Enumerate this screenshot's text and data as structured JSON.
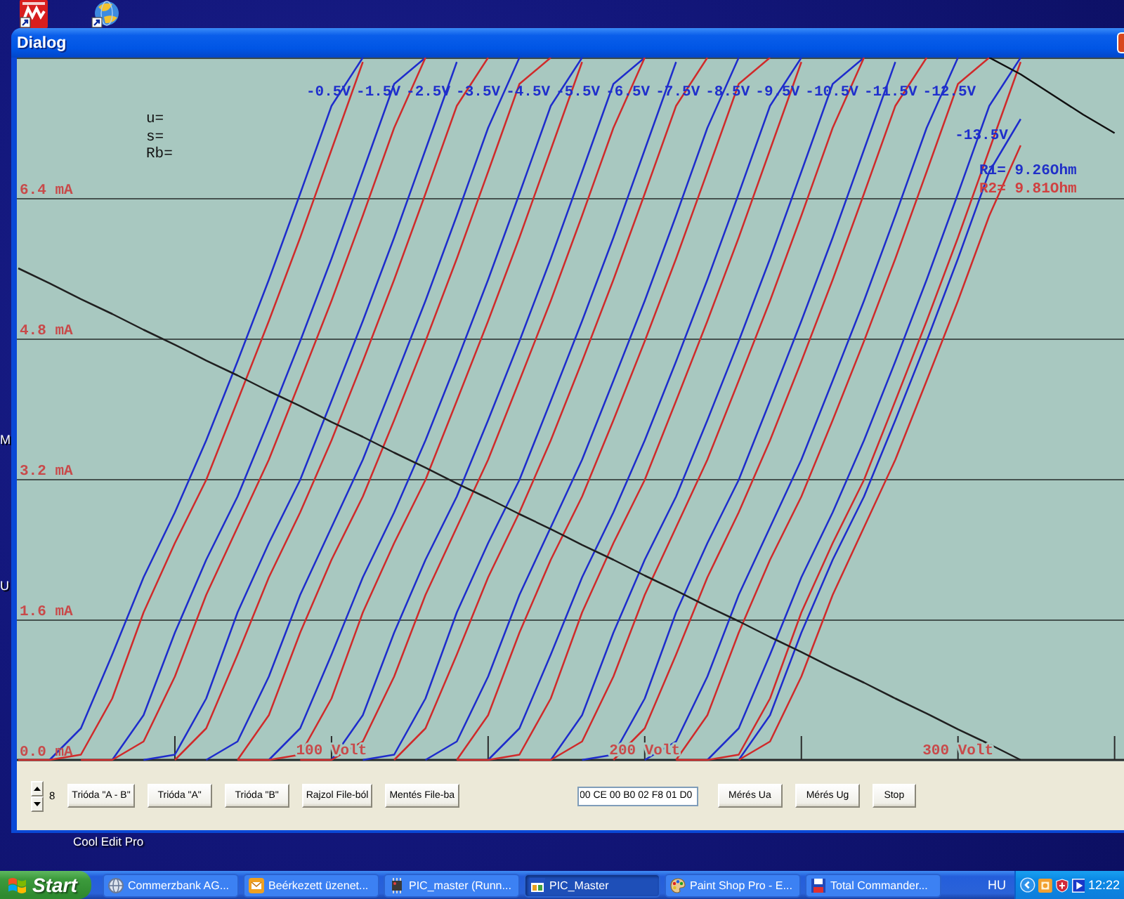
{
  "desktop": {
    "edge_labels": [
      "M",
      "U"
    ],
    "icon_label": "Cool Edit Pro"
  },
  "window": {
    "title": "Dialog"
  },
  "chart": {
    "parameters": [
      "u=",
      "s=",
      "Rb="
    ],
    "resistances": [
      {
        "text": "R1= 9.26Ohm",
        "color": "#2030c8"
      },
      {
        "text": "R2= 9.81Ohm",
        "color": "#d04040"
      }
    ],
    "chart_data": {
      "type": "line",
      "grid": true,
      "x": [
        0,
        10,
        20,
        30,
        40,
        50,
        60,
        70,
        80,
        90,
        100,
        110,
        120,
        130,
        140,
        150,
        160,
        170,
        180,
        190,
        200,
        210,
        220,
        230,
        240,
        250,
        260,
        270,
        280,
        290,
        300,
        310,
        320,
        330,
        340,
        350
      ],
      "xlim": [
        0,
        353
      ],
      "ylim": [
        0,
        8
      ],
      "xticks": [
        {
          "value": 100,
          "label": "100 Volt"
        },
        {
          "value": 200,
          "label": "200 Volt"
        },
        {
          "value": 300,
          "label": "300 Volt"
        }
      ],
      "yticks": [
        {
          "value": 0,
          "label": "0.0 mA"
        },
        {
          "value": 1.6,
          "label": "1.6 mA"
        },
        {
          "value": 3.2,
          "label": "3.2 mA"
        },
        {
          "value": 4.8,
          "label": "4.8 mA"
        },
        {
          "value": 6.4,
          "label": "6.4 mA"
        }
      ],
      "series": [
        {
          "color": "#1e2ccc",
          "values": [
            null,
            0,
            0.36,
            1.2,
            2.08,
            2.82,
            3.64,
            4.54,
            5.47,
            6.45,
            7.45,
            8,
            null,
            null,
            null,
            null,
            null,
            null,
            null,
            null,
            null,
            null,
            null,
            null,
            null,
            null,
            null,
            null,
            null,
            null,
            null,
            null,
            null,
            null,
            null,
            null
          ]
        },
        {
          "color": "#d02a2a",
          "values": [
            0,
            0,
            0.06,
            0.7,
            1.68,
            2.47,
            3.19,
            4.09,
            5.0,
            5.95,
            6.95,
            7.95,
            null,
            null,
            null,
            null,
            null,
            null,
            null,
            null,
            null,
            null,
            null,
            null,
            null,
            null,
            null,
            null,
            null,
            null,
            null,
            null,
            null,
            null,
            null,
            null
          ]
        },
        {
          "color": "#1e2ccc",
          "values": [
            null,
            null,
            null,
            0,
            0.51,
            1.45,
            2.28,
            3.0,
            3.87,
            4.77,
            5.71,
            6.7,
            7.7,
            8,
            null,
            null,
            null,
            null,
            null,
            null,
            null,
            null,
            null,
            null,
            null,
            null,
            null,
            null,
            null,
            null,
            null,
            null,
            null,
            null,
            null,
            null
          ]
        },
        {
          "color": "#d02a2a",
          "values": [
            null,
            null,
            0,
            0,
            0.21,
            0.95,
            1.88,
            2.65,
            3.42,
            4.32,
            5.23,
            6.2,
            7.2,
            8,
            null,
            null,
            null,
            null,
            null,
            null,
            null,
            null,
            null,
            null,
            null,
            null,
            null,
            null,
            null,
            null,
            null,
            null,
            null,
            null,
            null,
            null
          ]
        },
        {
          "color": "#1e2ccc",
          "values": [
            null,
            null,
            null,
            null,
            0,
            0.06,
            0.7,
            1.68,
            2.47,
            3.19,
            4.09,
            5.0,
            5.95,
            6.95,
            7.95,
            null,
            null,
            null,
            null,
            null,
            null,
            null,
            null,
            null,
            null,
            null,
            null,
            null,
            null,
            null,
            null,
            null,
            null,
            null,
            null,
            null
          ]
        },
        {
          "color": "#d02a2a",
          "values": [
            null,
            null,
            null,
            null,
            null,
            0,
            0.36,
            1.2,
            2.08,
            2.82,
            3.64,
            4.54,
            5.47,
            6.45,
            7.45,
            8,
            null,
            null,
            null,
            null,
            null,
            null,
            null,
            null,
            null,
            null,
            null,
            null,
            null,
            null,
            null,
            null,
            null,
            null,
            null,
            null
          ]
        },
        {
          "color": "#1e2ccc",
          "values": [
            null,
            null,
            null,
            null,
            null,
            null,
            0,
            0.21,
            0.95,
            1.88,
            2.65,
            3.42,
            4.32,
            5.23,
            6.2,
            7.2,
            8,
            null,
            null,
            null,
            null,
            null,
            null,
            null,
            null,
            null,
            null,
            null,
            null,
            null,
            null,
            null,
            null,
            null,
            null,
            null
          ]
        },
        {
          "color": "#d02a2a",
          "values": [
            null,
            null,
            null,
            null,
            null,
            null,
            null,
            0,
            0.51,
            1.45,
            2.28,
            3.0,
            3.87,
            4.77,
            5.71,
            6.7,
            7.7,
            8,
            null,
            null,
            null,
            null,
            null,
            null,
            null,
            null,
            null,
            null,
            null,
            null,
            null,
            null,
            null,
            null,
            null,
            null
          ]
        },
        {
          "color": "#1e2ccc",
          "values": [
            null,
            null,
            null,
            null,
            null,
            null,
            null,
            null,
            0,
            0.36,
            1.2,
            2.08,
            2.82,
            3.64,
            4.54,
            5.47,
            6.45,
            7.45,
            8,
            null,
            null,
            null,
            null,
            null,
            null,
            null,
            null,
            null,
            null,
            null,
            null,
            null,
            null,
            null,
            null,
            null
          ]
        },
        {
          "color": "#d02a2a",
          "values": [
            null,
            null,
            null,
            null,
            null,
            null,
            null,
            0,
            0,
            0.06,
            0.7,
            1.68,
            2.47,
            3.19,
            4.09,
            5.0,
            5.95,
            6.95,
            7.95,
            null,
            null,
            null,
            null,
            null,
            null,
            null,
            null,
            null,
            null,
            null,
            null,
            null,
            null,
            null,
            null,
            null
          ]
        },
        {
          "color": "#1e2ccc",
          "values": [
            null,
            null,
            null,
            null,
            null,
            null,
            null,
            null,
            null,
            null,
            0,
            0.51,
            1.45,
            2.28,
            3.0,
            3.87,
            4.77,
            5.71,
            6.7,
            7.7,
            8,
            null,
            null,
            null,
            null,
            null,
            null,
            null,
            null,
            null,
            null,
            null,
            null,
            null,
            null,
            null
          ]
        },
        {
          "color": "#d02a2a",
          "values": [
            null,
            null,
            null,
            null,
            null,
            null,
            null,
            null,
            null,
            0,
            0,
            0.21,
            0.95,
            1.88,
            2.65,
            3.42,
            4.32,
            5.23,
            6.2,
            7.2,
            8,
            null,
            null,
            null,
            null,
            null,
            null,
            null,
            null,
            null,
            null,
            null,
            null,
            null,
            null,
            null
          ]
        },
        {
          "color": "#1e2ccc",
          "values": [
            null,
            null,
            null,
            null,
            null,
            null,
            null,
            null,
            null,
            null,
            null,
            0,
            0.06,
            0.7,
            1.68,
            2.47,
            3.19,
            4.09,
            5.0,
            5.95,
            6.95,
            7.95,
            null,
            null,
            null,
            null,
            null,
            null,
            null,
            null,
            null,
            null,
            null,
            null,
            null,
            null
          ]
        },
        {
          "color": "#d02a2a",
          "values": [
            null,
            null,
            null,
            null,
            null,
            null,
            null,
            null,
            null,
            null,
            null,
            null,
            0,
            0.36,
            1.2,
            2.08,
            2.82,
            3.64,
            4.54,
            5.47,
            6.45,
            7.45,
            8,
            null,
            null,
            null,
            null,
            null,
            null,
            null,
            null,
            null,
            null,
            null,
            null,
            null
          ]
        },
        {
          "color": "#1e2ccc",
          "values": [
            null,
            null,
            null,
            null,
            null,
            null,
            null,
            null,
            null,
            null,
            null,
            null,
            null,
            0,
            0.21,
            0.95,
            1.88,
            2.65,
            3.42,
            4.32,
            5.23,
            6.2,
            7.2,
            8,
            null,
            null,
            null,
            null,
            null,
            null,
            null,
            null,
            null,
            null,
            null,
            null
          ]
        },
        {
          "color": "#d02a2a",
          "values": [
            null,
            null,
            null,
            null,
            null,
            null,
            null,
            null,
            null,
            null,
            null,
            null,
            null,
            null,
            0,
            0.51,
            1.45,
            2.28,
            3.0,
            3.87,
            4.77,
            5.71,
            6.7,
            7.7,
            8,
            null,
            null,
            null,
            null,
            null,
            null,
            null,
            null,
            null,
            null,
            null
          ]
        },
        {
          "color": "#1e2ccc",
          "values": [
            null,
            null,
            null,
            null,
            null,
            null,
            null,
            null,
            null,
            null,
            null,
            null,
            null,
            null,
            null,
            0,
            0.36,
            1.2,
            2.08,
            2.82,
            3.64,
            4.54,
            5.47,
            6.45,
            7.45,
            8,
            null,
            null,
            null,
            null,
            null,
            null,
            null,
            null,
            null,
            null
          ]
        },
        {
          "color": "#d02a2a",
          "values": [
            null,
            null,
            null,
            null,
            null,
            null,
            null,
            null,
            null,
            null,
            null,
            null,
            null,
            null,
            0,
            0,
            0.06,
            0.7,
            1.68,
            2.47,
            3.19,
            4.09,
            5.0,
            5.95,
            6.95,
            7.95,
            null,
            null,
            null,
            null,
            null,
            null,
            null,
            null,
            null,
            null
          ]
        },
        {
          "color": "#1e2ccc",
          "values": [
            null,
            null,
            null,
            null,
            null,
            null,
            null,
            null,
            null,
            null,
            null,
            null,
            null,
            null,
            null,
            null,
            null,
            0,
            0.51,
            1.45,
            2.28,
            3.0,
            3.87,
            4.77,
            5.71,
            6.7,
            7.7,
            8,
            null,
            null,
            null,
            null,
            null,
            null,
            null,
            null
          ]
        },
        {
          "color": "#d02a2a",
          "values": [
            null,
            null,
            null,
            null,
            null,
            null,
            null,
            null,
            null,
            null,
            null,
            null,
            null,
            null,
            null,
            null,
            0,
            0,
            0.21,
            0.95,
            1.88,
            2.65,
            3.42,
            4.32,
            5.23,
            6.2,
            7.2,
            8,
            null,
            null,
            null,
            null,
            null,
            null,
            null,
            null
          ]
        },
        {
          "color": "#1e2ccc",
          "values": [
            null,
            null,
            null,
            null,
            null,
            null,
            null,
            null,
            null,
            null,
            null,
            null,
            null,
            null,
            null,
            null,
            null,
            null,
            0,
            0.06,
            0.7,
            1.68,
            2.47,
            3.19,
            4.09,
            5.0,
            5.95,
            6.95,
            7.95,
            null,
            null,
            null,
            null,
            null,
            null,
            null
          ]
        },
        {
          "color": "#d02a2a",
          "values": [
            null,
            null,
            null,
            null,
            null,
            null,
            null,
            null,
            null,
            null,
            null,
            null,
            null,
            null,
            null,
            null,
            null,
            null,
            null,
            0,
            0.36,
            1.2,
            2.08,
            2.82,
            3.64,
            4.54,
            5.47,
            6.45,
            7.45,
            8,
            null,
            null,
            null,
            null,
            null,
            null
          ]
        },
        {
          "color": "#1e2ccc",
          "values": [
            null,
            null,
            null,
            null,
            null,
            null,
            null,
            null,
            null,
            null,
            null,
            null,
            null,
            null,
            null,
            null,
            null,
            null,
            null,
            null,
            0,
            0.21,
            0.95,
            1.88,
            2.65,
            3.42,
            4.32,
            5.23,
            6.2,
            7.2,
            8,
            null,
            null,
            null,
            null,
            null
          ]
        },
        {
          "color": "#d02a2a",
          "values": [
            null,
            null,
            null,
            null,
            null,
            null,
            null,
            null,
            null,
            null,
            null,
            null,
            null,
            null,
            null,
            null,
            null,
            null,
            null,
            null,
            null,
            0,
            0.51,
            1.45,
            2.28,
            3.0,
            3.87,
            4.77,
            5.71,
            6.7,
            7.7,
            8,
            null,
            null,
            null,
            null
          ]
        },
        {
          "color": "#1e2ccc",
          "values": [
            null,
            null,
            null,
            null,
            null,
            null,
            null,
            null,
            null,
            null,
            null,
            null,
            null,
            null,
            null,
            null,
            null,
            null,
            null,
            null,
            null,
            null,
            0,
            0.36,
            1.2,
            2.08,
            2.82,
            3.64,
            4.54,
            5.47,
            6.45,
            7.45,
            8,
            null,
            null,
            null
          ]
        },
        {
          "color": "#d02a2a",
          "values": [
            null,
            null,
            null,
            null,
            null,
            null,
            null,
            null,
            null,
            null,
            null,
            null,
            null,
            null,
            null,
            null,
            null,
            null,
            null,
            null,
            null,
            0,
            0,
            0.06,
            0.7,
            1.68,
            2.47,
            3.19,
            4.09,
            5.0,
            5.95,
            6.95,
            7.95,
            null,
            null,
            null
          ]
        },
        {
          "color": "#1e2ccc",
          "values": [
            null,
            null,
            null,
            null,
            null,
            null,
            null,
            null,
            null,
            null,
            null,
            null,
            null,
            null,
            null,
            null,
            null,
            null,
            null,
            null,
            null,
            null,
            null,
            0,
            0.51,
            1.45,
            2.28,
            3.0,
            3.87,
            4.77,
            5.71,
            6.7,
            7.3,
            null,
            null,
            null
          ]
        },
        {
          "color": "#d02a2a",
          "values": [
            null,
            null,
            null,
            null,
            null,
            null,
            null,
            null,
            null,
            null,
            null,
            null,
            null,
            null,
            null,
            null,
            null,
            null,
            null,
            null,
            null,
            null,
            null,
            0,
            0.21,
            0.95,
            1.88,
            2.65,
            3.42,
            4.32,
            5.23,
            6.2,
            7.0,
            null,
            null,
            null
          ]
        },
        {
          "color": "#202020",
          "values": [
            5.6,
            5.43,
            5.25,
            5.08,
            4.9,
            4.73,
            4.55,
            4.38,
            4.2,
            4.03,
            3.85,
            3.68,
            3.5,
            3.33,
            3.15,
            2.98,
            2.8,
            2.63,
            2.45,
            2.28,
            2.1,
            1.93,
            1.75,
            1.58,
            1.4,
            1.23,
            1.05,
            0.88,
            0.7,
            0.53,
            0.35,
            0.18,
            0,
            null,
            null,
            null
          ]
        },
        {
          "color": "#101010",
          "values": [
            null,
            null,
            null,
            null,
            null,
            null,
            null,
            null,
            null,
            null,
            null,
            null,
            null,
            null,
            null,
            null,
            null,
            null,
            null,
            null,
            null,
            null,
            null,
            null,
            null,
            null,
            null,
            null,
            null,
            null,
            null,
            8,
            7.81,
            7.58,
            7.35,
            7.14
          ]
        }
      ],
      "annotations": [
        "-0.5V",
        "-1.5V",
        "-2.5V",
        "-3.5V",
        "-4.5V",
        "-5.5V",
        "-6.5V",
        "-7.5V",
        "-8.5V",
        "-9.5V",
        "-10.5V",
        "-11.5V",
        "-12.5V",
        "-13.5V"
      ]
    }
  },
  "controls": {
    "spin_value": "8",
    "buttons": [
      "Trióda \"A - B\"",
      "Trióda \"A\"",
      "Trióda \"B\"",
      "Rajzol File-ból",
      "Mentés File-ba"
    ],
    "data_field": {
      "value": "00 CE 00 B0 02 F8 01 D0"
    },
    "measure_buttons": [
      "Mérés Ua",
      "Mérés Ug",
      "Stop"
    ]
  },
  "taskbar": {
    "start": "Start",
    "tasks": [
      {
        "label": "Commerzbank AG...",
        "selected": false
      },
      {
        "label": "Beérkezett üzenet...",
        "selected": false
      },
      {
        "label": "PIC_master (Runn...",
        "selected": false
      },
      {
        "label": "PIC_Master",
        "selected": true
      },
      {
        "label": "Paint Shop Pro - E...",
        "selected": false
      },
      {
        "label": "Total Commander...",
        "selected": false
      }
    ],
    "language": "HU",
    "clock": "12:22"
  }
}
